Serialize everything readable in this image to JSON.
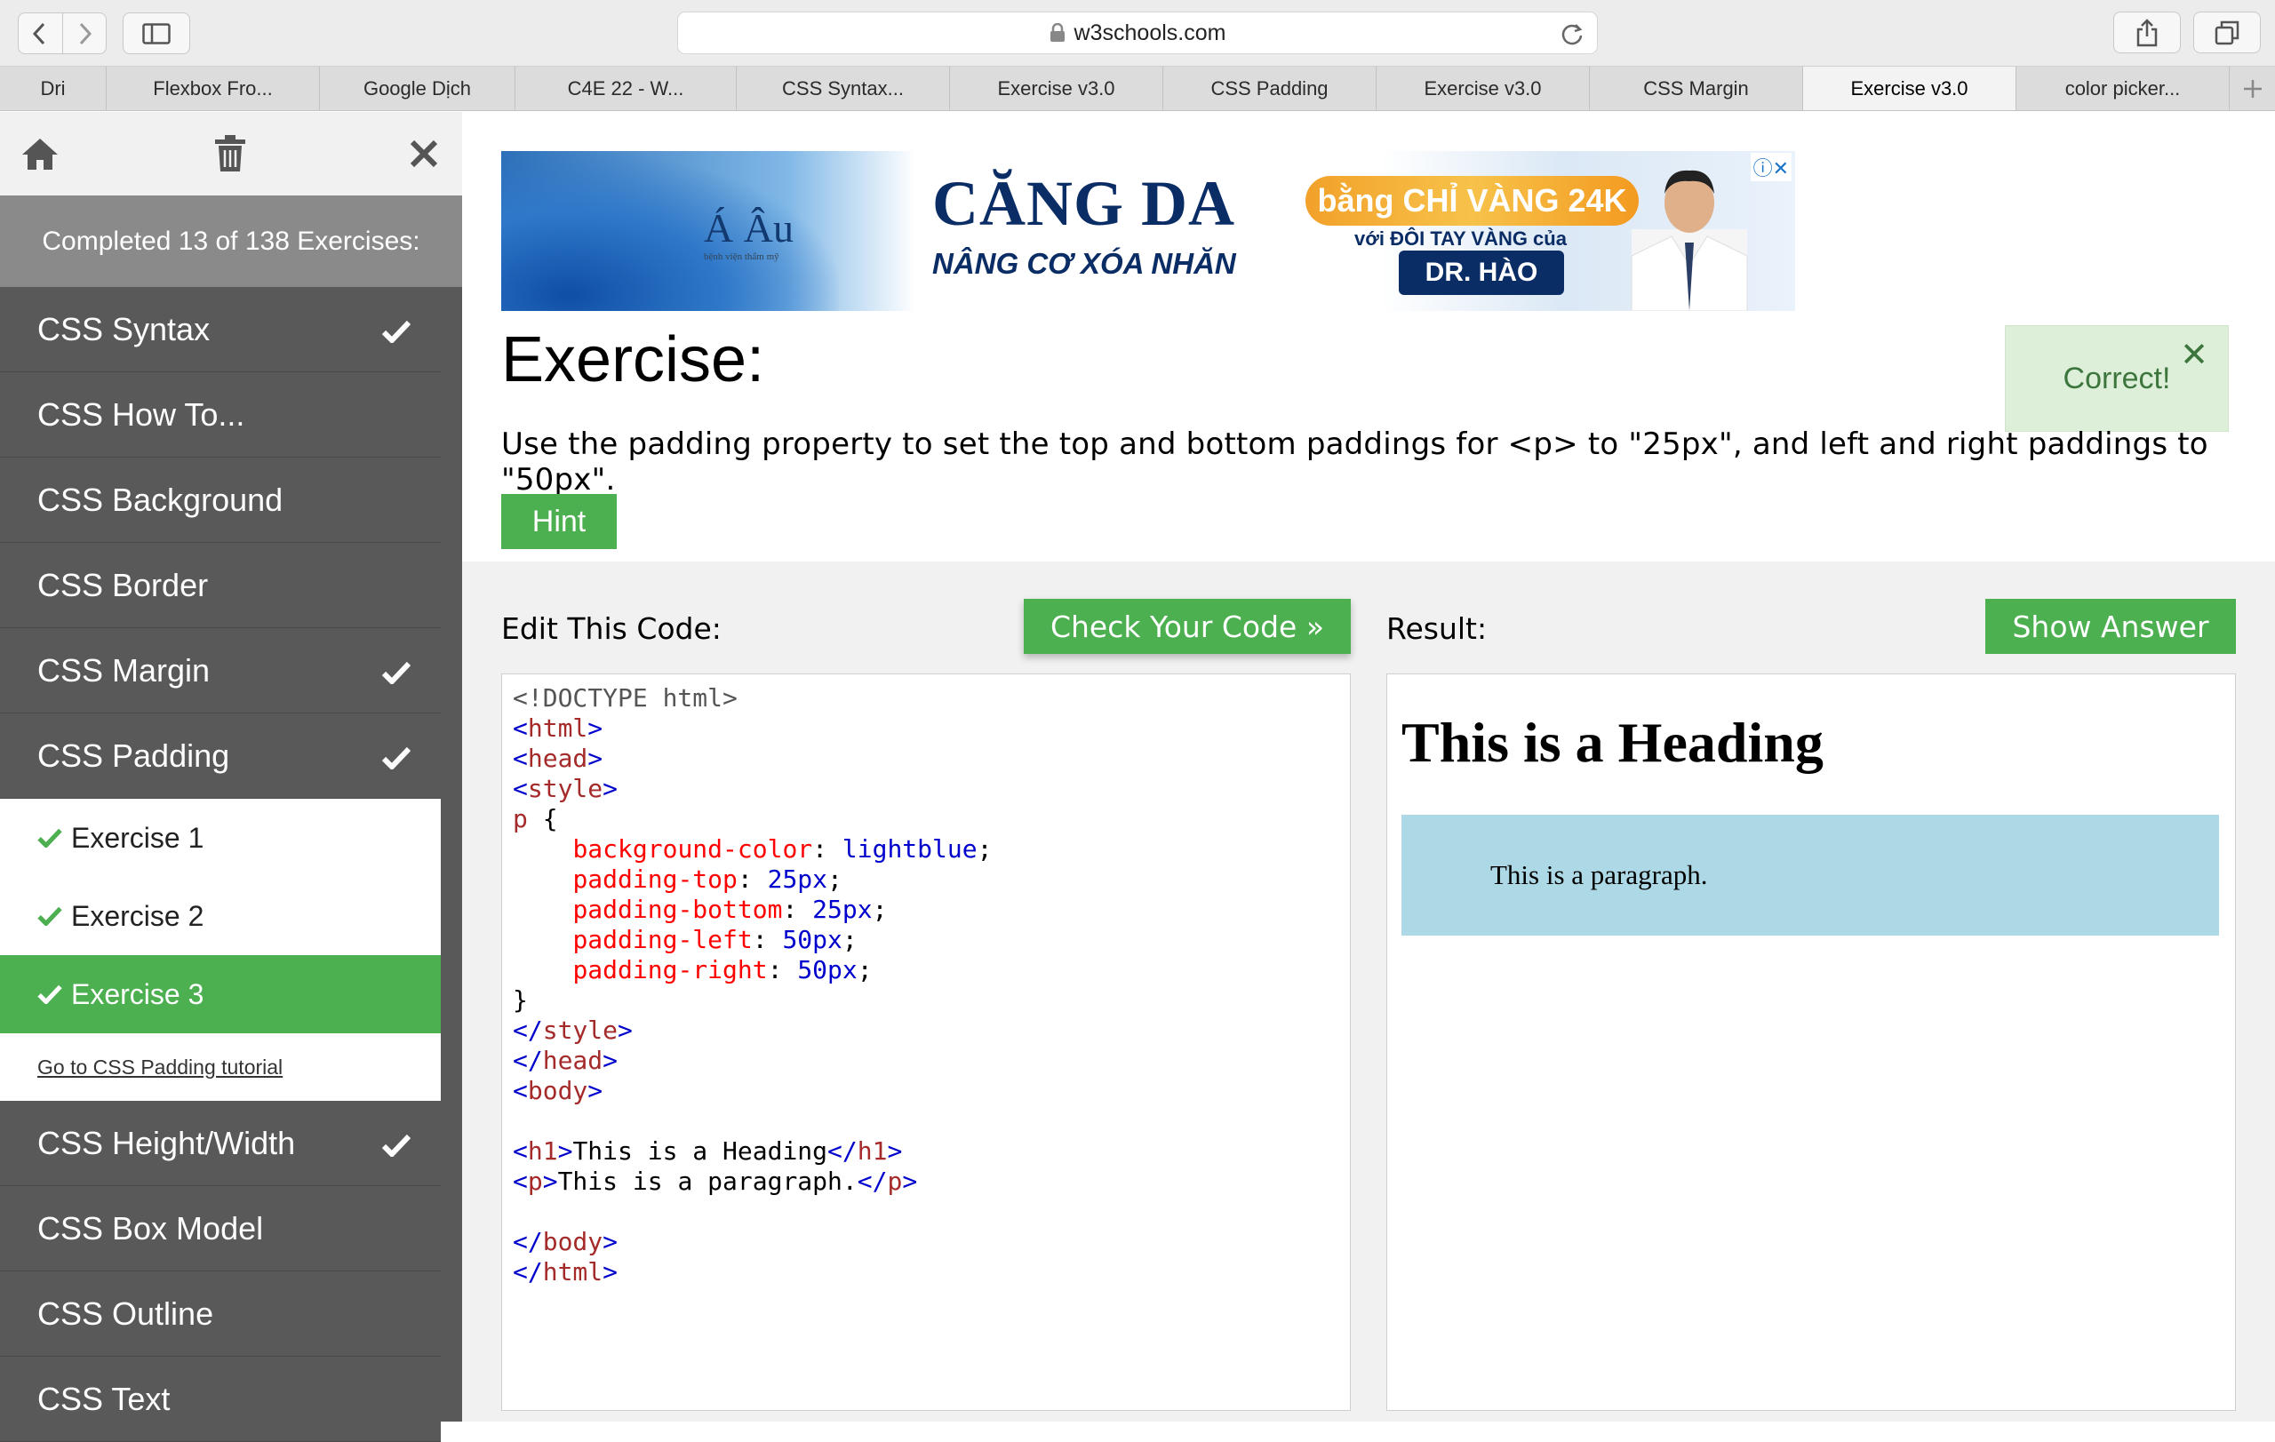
{
  "browser": {
    "url": "w3schools.com",
    "tabs": [
      "Dri",
      "Flexbox Fro...",
      "Google Dịch",
      "C4E 22 - W...",
      "CSS Syntax...",
      "Exercise v3.0",
      "CSS Padding",
      "Exercise v3.0",
      "CSS Margin",
      "Exercise v3.0",
      "color picker..."
    ],
    "active_tab_index": 9
  },
  "sidebar": {
    "progress": "Completed 13 of 138 Exercises:",
    "items_before": [
      {
        "label": "CSS Syntax",
        "done": true
      },
      {
        "label": "CSS How To...",
        "done": false
      },
      {
        "label": "CSS Background",
        "done": false
      },
      {
        "label": "CSS Border",
        "done": false
      },
      {
        "label": "CSS Margin",
        "done": true
      },
      {
        "label": "CSS Padding",
        "done": true
      }
    ],
    "sub_items": [
      {
        "label": "Exercise 1",
        "done": true
      },
      {
        "label": "Exercise 2",
        "done": true
      },
      {
        "label": "Exercise 3",
        "done": true
      }
    ],
    "tutorial_link": "Go to CSS Padding tutorial",
    "items_after": [
      {
        "label": "CSS Height/Width",
        "done": true
      },
      {
        "label": "CSS Box Model",
        "done": false
      },
      {
        "label": "CSS Outline",
        "done": false
      },
      {
        "label": "CSS Text",
        "done": false
      }
    ]
  },
  "ad": {
    "logo": "Á Âu",
    "logo_sub": "bệnh viện thẩm mỹ",
    "headline": "CĂNG DA",
    "sub": "NÂNG CƠ XÓA NHĂN",
    "gold": "bằng CHỈ VÀNG 24K",
    "with": "với ĐÔI TAY VÀNG của",
    "doctor": "DR. HÀO"
  },
  "exercise": {
    "title": "Exercise:",
    "instructions": "Use the padding property to set the top and bottom paddings for <p> to \"25px\", and left and right paddings to \"50px\".",
    "hint_label": "Hint",
    "correct_text": "Correct!",
    "edit_label": "Edit This Code:",
    "check_label": "Check Your Code »",
    "result_label": "Result:",
    "answer_label": "Show Answer"
  },
  "code": {
    "doctype": "<!DOCTYPE html>",
    "selector": "p",
    "declarations": [
      {
        "prop": "background-color",
        "value": "lightblue"
      },
      {
        "prop": "padding-top",
        "value": "25px"
      },
      {
        "prop": "padding-bottom",
        "value": "25px"
      },
      {
        "prop": "padding-left",
        "value": "50px"
      },
      {
        "prop": "padding-right",
        "value": "50px"
      }
    ],
    "h1_text": "This is a Heading",
    "p_text": "This is a paragraph."
  },
  "result": {
    "heading": "This is a Heading",
    "paragraph": "This is a paragraph."
  },
  "colors": {
    "accent_green": "#4caf50",
    "sidebar_bg": "#595959",
    "paragraph_bg": "lightblue"
  }
}
